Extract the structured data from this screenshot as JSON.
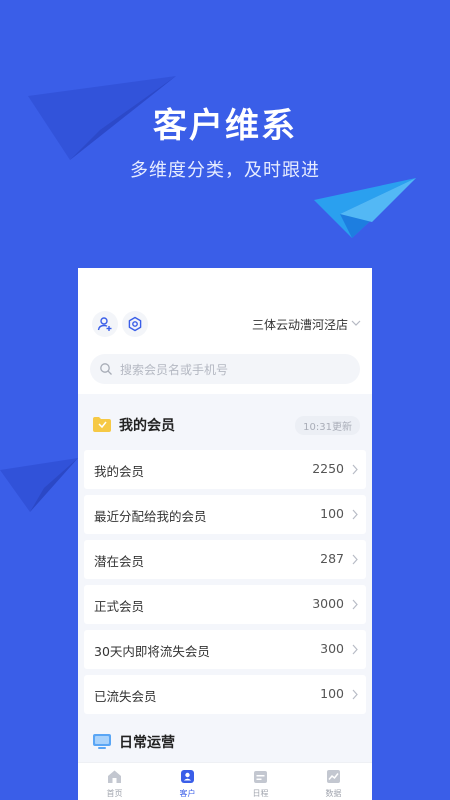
{
  "promo": {
    "title": "客户维系",
    "subtitle": "多维度分类，及时跟进"
  },
  "header": {
    "store_name": "三体云动漕河泾店",
    "search_placeholder": "搜索会员名或手机号"
  },
  "members_section": {
    "title": "我的会员",
    "update_time": "10:31更新",
    "rows": [
      {
        "label": "我的会员",
        "value": "2250"
      },
      {
        "label": "最近分配给我的会员",
        "value": "100"
      },
      {
        "label": "潜在会员",
        "value": "287"
      },
      {
        "label": "正式会员",
        "value": "3000"
      },
      {
        "label": "30天内即将流失会员",
        "value": "300"
      },
      {
        "label": "已流失会员",
        "value": "100"
      }
    ]
  },
  "operations_section": {
    "title": "日常运营"
  },
  "tabbar": {
    "active": "客户",
    "tabs": [
      {
        "label": "首页",
        "icon": "home-icon"
      },
      {
        "label": "客户",
        "icon": "customer-icon"
      },
      {
        "label": "日程",
        "icon": "schedule-icon"
      },
      {
        "label": "数据",
        "icon": "data-icon"
      }
    ]
  },
  "colors": {
    "background": "#3a5ee8",
    "accent": "#3a5ee8",
    "folder_yellow": "#f6c945"
  }
}
